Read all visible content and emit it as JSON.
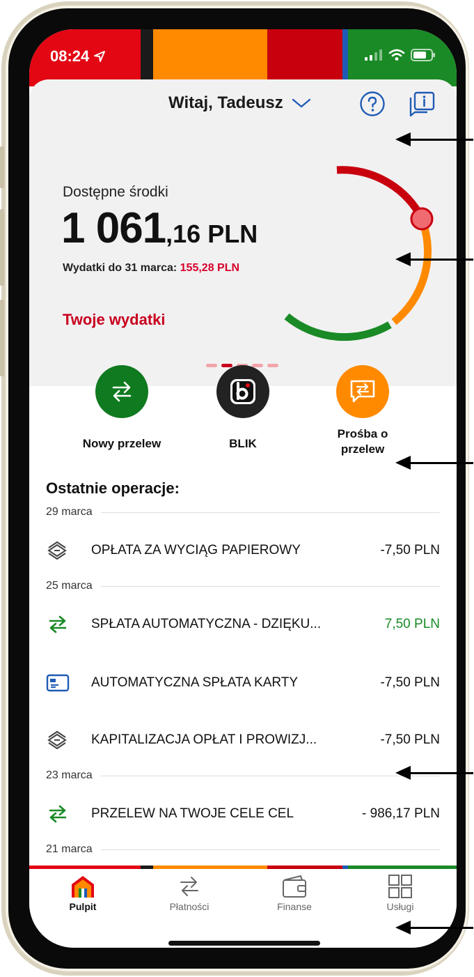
{
  "status": {
    "time": "08:24"
  },
  "colors": {
    "red": "#e30613",
    "orange": "#ff8a00",
    "darkred": "#c8000e",
    "green": "#1a8a26",
    "blue": "#1f5bb5",
    "black": "#1a1a1a"
  },
  "header": {
    "greeting": "Witaj, Tadeusz"
  },
  "balance": {
    "label": "Dostępne środki",
    "amount_whole": "1 061",
    "amount_fraction": ",16 PLN",
    "expenses_prefix": "Wydatki do 31 marca: ",
    "expenses_value": "155,28 PLN",
    "link": "Twoje wydatki",
    "page_indicator": {
      "count": 5,
      "active": 2
    }
  },
  "actions": [
    {
      "label": "Nowy przelew"
    },
    {
      "label": "BLIK"
    },
    {
      "label": "Prośba o przelew"
    }
  ],
  "operations": {
    "title": "Ostatnie operacje:",
    "dates": [
      "29 marca",
      "25 marca",
      "23 marca",
      "21 marca"
    ],
    "items": [
      {
        "name": "OPŁATA ZA WYCIĄG PAPIEROWY",
        "amount": "-7,50 PLN",
        "icon": "money-stack-icon"
      },
      {
        "name": "SPŁATA AUTOMATYCZNA - DZIĘKU...",
        "amount": "7,50 PLN",
        "icon": "transfer-icon"
      },
      {
        "name": "AUTOMATYCZNA SPŁATA KARTY",
        "amount": "-7,50 PLN",
        "icon": "card-icon"
      },
      {
        "name": "KAPITALIZACJA OPŁAT I PROWIZJ...",
        "amount": "-7,50 PLN",
        "icon": "money-stack-icon"
      },
      {
        "name": "PRZELEW NA TWOJE CELE CEL",
        "amount": "- 986,17 PLN",
        "icon": "transfer-icon"
      }
    ]
  },
  "nav": [
    {
      "label": "Pulpit",
      "active": true
    },
    {
      "label": "Płatności"
    },
    {
      "label": "Finanse"
    },
    {
      "label": "Usługi"
    }
  ]
}
